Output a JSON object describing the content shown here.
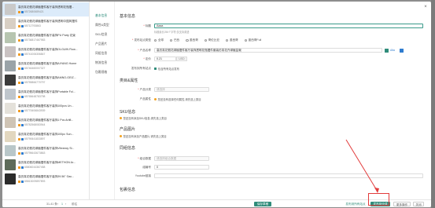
{
  "left_list": {
    "items": [
      {
        "title": "高仿真花假花绿植摆件客厅装饰透明花瓶摆...",
        "sub": "6572680689421"
      },
      {
        "title": "高仿真花假花绿植摆件客厅装饰透明中国风摆件",
        "sub": "65712793863"
      },
      {
        "title": "高仿真花假花绿植摆件客厅装饰PU Party 花束",
        "sub": "65736817467983"
      },
      {
        "title": "高仿真花假花绿植摆件客厅装饰OLGUIN Flow...",
        "sub": "65741006306847"
      },
      {
        "title": "高仿真花假花绿植摆件客厅装饰AIYANG Home",
        "sub": "65746460007327"
      },
      {
        "title": "高仿真花假花绿植摆件客厅装饰AMNO-GEIZ...",
        "sub": "65755866770797"
      },
      {
        "title": "高仿真花假花绿植摆件客厅装饰Portable Fol...",
        "sub": "65765648783798"
      },
      {
        "title": "高仿真花假花绿植摆件客厅装饰100pcs Un...",
        "sub": "65770606843939"
      },
      {
        "title": "高仿真花假花绿植摆件客厅装饰1 Pcs Artifi...",
        "sub": "65782568083944"
      },
      {
        "title": "高仿真花假花绿植摆件客厅装饰100pc Sun...",
        "sub": "65790641833897"
      },
      {
        "title": "高仿真花假花绿植摆件客厅装饰Vibrancy Si...",
        "sub": "65795643673863"
      },
      {
        "title": "高仿真花假花绿植摆件客厅装饰METHON Ar...",
        "sub": "65806044367458"
      },
      {
        "title": "高仿真花假花绿植摆件客厅装饰39.56\" Gac...",
        "sub": "65813009897893"
      }
    ],
    "pager": {
      "range": "31-41 条",
      "prev": "‹",
      "page": "1",
      "next": "›",
      "jump": "前往"
    }
  },
  "mid_nav": [
    {
      "label": "基本信息",
      "active": true
    },
    {
      "label": "属性&类型",
      "active": false
    },
    {
      "label": "SKU信息",
      "active": false
    },
    {
      "label": "产品图片",
      "active": false
    },
    {
      "label": "同组信息",
      "active": false
    },
    {
      "label": "物流信息",
      "active": false
    },
    {
      "label": "包裹规格",
      "active": false
    }
  ],
  "form": {
    "section_basic": "基本信息",
    "title_label": "标题",
    "title_value": "Aaaa",
    "title_hint": "标题最长256个字符,仅支持英语",
    "type_label": "发布站点类型",
    "type_options": [
      "全球",
      "巴西",
      "墨西哥",
      "哥伦比亚",
      "墨西哥",
      "墨西哥Full"
    ],
    "product_label": "产品名称",
    "product_value": "高仿真花假花绿植摆件客厅装饰透明花瓶摆件套装仿真花卉绿植盆栽",
    "product_tag": "Alta",
    "price_label": "定价",
    "price_value": "0.21",
    "price_unit": "USD",
    "publish_label": "发布到所有站点",
    "publish_text": "包含所有站点发布",
    "section_attr": "类目&属性",
    "category_label": "产品分类",
    "category_placeholder": "请选择",
    "attr_label": "产品属性",
    "attr_warn": "您还没有选择任何属性,请先选上类目",
    "section_sku": "SKU信息",
    "sku_warn": "您还没有添加SKU信息,请先选上类目",
    "section_img": "产品图片",
    "img_warn": "您还没有添加产品图片,请先选上类目",
    "section_group": "同组信息",
    "group_label": "组合数据",
    "group_placeholder": "请选择组合数据",
    "group_id_label": "组编号",
    "group_id_value": "0",
    "youtube_label": "Youtube链接",
    "section_pkg": "包裹信息"
  },
  "footer": {
    "save_label": "保存草稿",
    "publish_all_label": "发布到所有站点",
    "publish_label": "发布到全球",
    "more_label": "更多操作",
    "close_label": "关闭"
  },
  "colors": {
    "accent": "#2f8c7a",
    "highlight": "#e23b3b"
  }
}
